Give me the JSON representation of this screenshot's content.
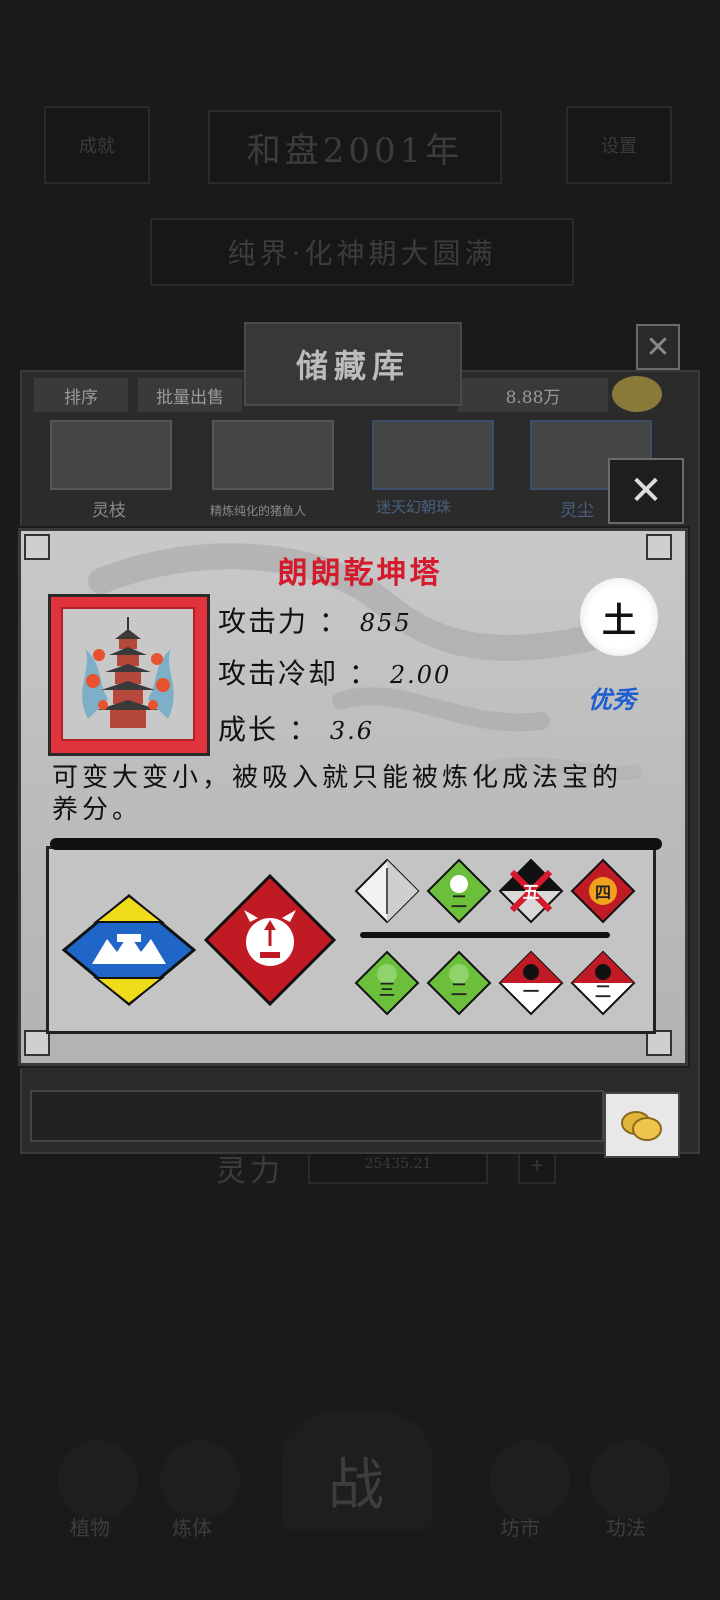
{
  "background": {
    "header_left": "成就",
    "header_center": "和盘2001年",
    "header_right": "设置",
    "banner": "纯界·化神期大圆满",
    "spirit_label": "灵力",
    "spirit_value": "25435.21",
    "nav": [
      "植物",
      "炼体",
      "战",
      "坊市",
      "功法"
    ]
  },
  "storage": {
    "title": "储藏库",
    "tab_sort": "排序",
    "tab_bulk_sell": "批量出售",
    "currency": "8.88万",
    "slots": [
      {
        "label": "灵枝"
      },
      {
        "label": "精炼纯化的猪鱼人"
      },
      {
        "label": "迷天幻朝珠"
      },
      {
        "label": "灵尘"
      }
    ],
    "close_icon": "close-icon"
  },
  "item": {
    "name": "朗朗乾坤塔",
    "attack_label": "攻击力",
    "attack_value": "855",
    "cooldown_label": "攻击冷却",
    "cooldown_value": "2.00",
    "growth_label": "成长",
    "growth_value": "3.6",
    "element": "土",
    "grade": "优秀",
    "description": "可变大变小，被吸入就只能被炼化成法宝的养分。",
    "colors": {
      "name": "#d41a2c",
      "grade": "#1d5fd0",
      "frame": "#e0333b"
    }
  },
  "skills": {
    "big": [
      {
        "name": "water-shield-skill-icon"
      },
      {
        "name": "demon-attack-up-skill-icon"
      }
    ],
    "small": [
      {
        "name": "white-arrow-skill-icon",
        "label": ""
      },
      {
        "name": "green-level-skill-icon",
        "label": "二"
      },
      {
        "name": "forbidden-five-skill-icon",
        "label": "五"
      },
      {
        "name": "fire-four-skill-icon",
        "label": "四"
      },
      {
        "name": "green-three-skill-icon",
        "label": "三"
      },
      {
        "name": "green-two-skill-icon",
        "label": "二"
      },
      {
        "name": "red-one-skill-icon",
        "label": "一"
      },
      {
        "name": "red-two-skill-icon",
        "label": "二"
      }
    ]
  }
}
